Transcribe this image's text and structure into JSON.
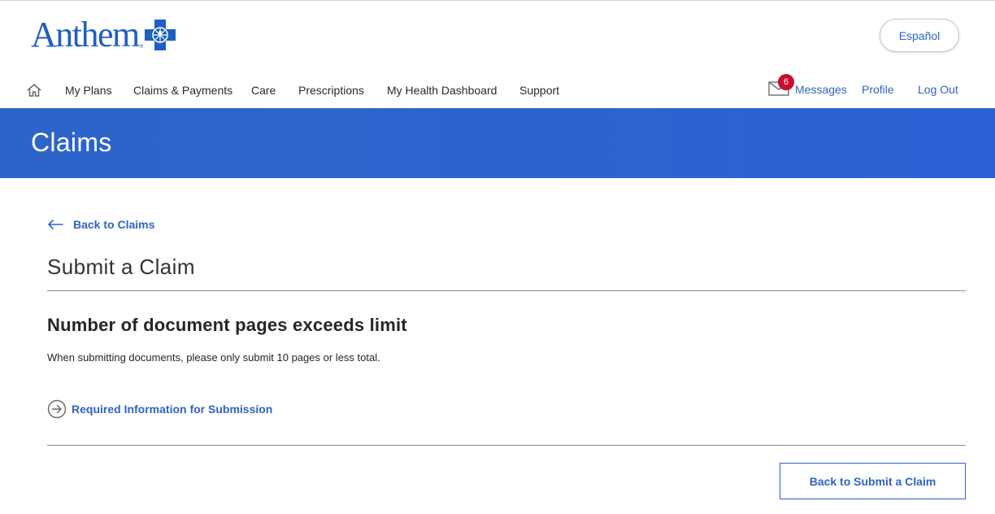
{
  "brand": {
    "logo_text": "Anthem",
    "logo_reg": "®",
    "accent_color": "#2e63c9",
    "banner_color": "#2d64c9"
  },
  "header": {
    "language_button": "Español",
    "nav": {
      "home_icon": "home-icon",
      "items": [
        {
          "label": "My Plans"
        },
        {
          "label": "Claims & Payments"
        },
        {
          "label": "Care"
        },
        {
          "label": "Prescriptions"
        },
        {
          "label": "My Health Dashboard"
        },
        {
          "label": "Support"
        }
      ]
    },
    "messages": {
      "icon": "envelope-icon",
      "badge_count": "6",
      "label": "Messages"
    },
    "profile_label": "Profile",
    "logout_label": "Log Out"
  },
  "banner": {
    "title": "Claims"
  },
  "main": {
    "back_link": "Back to Claims",
    "page_title": "Submit a Claim",
    "error_heading": "Number of document pages exceeds limit",
    "error_description": "When submitting documents, please only submit 10 pages or less total.",
    "info_link": "Required Information for Submission",
    "primary_button": "Back to Submit a Claim"
  }
}
